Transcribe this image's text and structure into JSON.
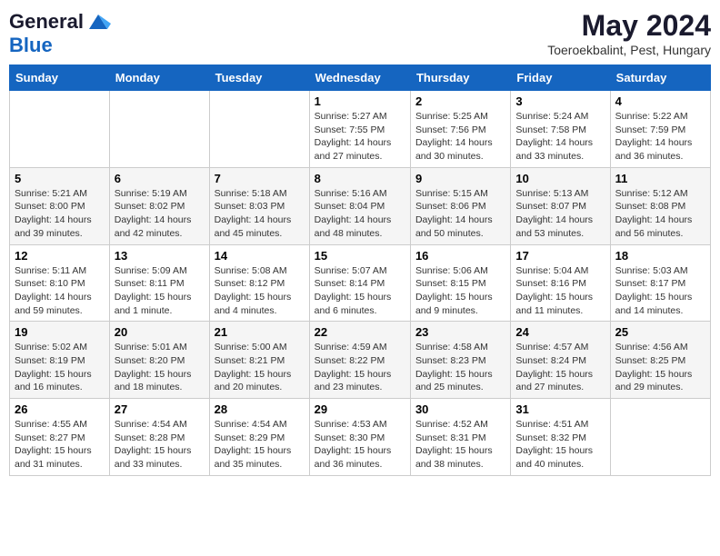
{
  "header": {
    "logo_general": "General",
    "logo_blue": "Blue",
    "month_year": "May 2024",
    "location": "Toeroekbalint, Pest, Hungary"
  },
  "weekdays": [
    "Sunday",
    "Monday",
    "Tuesday",
    "Wednesday",
    "Thursday",
    "Friday",
    "Saturday"
  ],
  "weeks": [
    [
      {
        "day": "",
        "info": ""
      },
      {
        "day": "",
        "info": ""
      },
      {
        "day": "",
        "info": ""
      },
      {
        "day": "1",
        "info": "Sunrise: 5:27 AM\nSunset: 7:55 PM\nDaylight: 14 hours\nand 27 minutes."
      },
      {
        "day": "2",
        "info": "Sunrise: 5:25 AM\nSunset: 7:56 PM\nDaylight: 14 hours\nand 30 minutes."
      },
      {
        "day": "3",
        "info": "Sunrise: 5:24 AM\nSunset: 7:58 PM\nDaylight: 14 hours\nand 33 minutes."
      },
      {
        "day": "4",
        "info": "Sunrise: 5:22 AM\nSunset: 7:59 PM\nDaylight: 14 hours\nand 36 minutes."
      }
    ],
    [
      {
        "day": "5",
        "info": "Sunrise: 5:21 AM\nSunset: 8:00 PM\nDaylight: 14 hours\nand 39 minutes."
      },
      {
        "day": "6",
        "info": "Sunrise: 5:19 AM\nSunset: 8:02 PM\nDaylight: 14 hours\nand 42 minutes."
      },
      {
        "day": "7",
        "info": "Sunrise: 5:18 AM\nSunset: 8:03 PM\nDaylight: 14 hours\nand 45 minutes."
      },
      {
        "day": "8",
        "info": "Sunrise: 5:16 AM\nSunset: 8:04 PM\nDaylight: 14 hours\nand 48 minutes."
      },
      {
        "day": "9",
        "info": "Sunrise: 5:15 AM\nSunset: 8:06 PM\nDaylight: 14 hours\nand 50 minutes."
      },
      {
        "day": "10",
        "info": "Sunrise: 5:13 AM\nSunset: 8:07 PM\nDaylight: 14 hours\nand 53 minutes."
      },
      {
        "day": "11",
        "info": "Sunrise: 5:12 AM\nSunset: 8:08 PM\nDaylight: 14 hours\nand 56 minutes."
      }
    ],
    [
      {
        "day": "12",
        "info": "Sunrise: 5:11 AM\nSunset: 8:10 PM\nDaylight: 14 hours\nand 59 minutes."
      },
      {
        "day": "13",
        "info": "Sunrise: 5:09 AM\nSunset: 8:11 PM\nDaylight: 15 hours\nand 1 minute."
      },
      {
        "day": "14",
        "info": "Sunrise: 5:08 AM\nSunset: 8:12 PM\nDaylight: 15 hours\nand 4 minutes."
      },
      {
        "day": "15",
        "info": "Sunrise: 5:07 AM\nSunset: 8:14 PM\nDaylight: 15 hours\nand 6 minutes."
      },
      {
        "day": "16",
        "info": "Sunrise: 5:06 AM\nSunset: 8:15 PM\nDaylight: 15 hours\nand 9 minutes."
      },
      {
        "day": "17",
        "info": "Sunrise: 5:04 AM\nSunset: 8:16 PM\nDaylight: 15 hours\nand 11 minutes."
      },
      {
        "day": "18",
        "info": "Sunrise: 5:03 AM\nSunset: 8:17 PM\nDaylight: 15 hours\nand 14 minutes."
      }
    ],
    [
      {
        "day": "19",
        "info": "Sunrise: 5:02 AM\nSunset: 8:19 PM\nDaylight: 15 hours\nand 16 minutes."
      },
      {
        "day": "20",
        "info": "Sunrise: 5:01 AM\nSunset: 8:20 PM\nDaylight: 15 hours\nand 18 minutes."
      },
      {
        "day": "21",
        "info": "Sunrise: 5:00 AM\nSunset: 8:21 PM\nDaylight: 15 hours\nand 20 minutes."
      },
      {
        "day": "22",
        "info": "Sunrise: 4:59 AM\nSunset: 8:22 PM\nDaylight: 15 hours\nand 23 minutes."
      },
      {
        "day": "23",
        "info": "Sunrise: 4:58 AM\nSunset: 8:23 PM\nDaylight: 15 hours\nand 25 minutes."
      },
      {
        "day": "24",
        "info": "Sunrise: 4:57 AM\nSunset: 8:24 PM\nDaylight: 15 hours\nand 27 minutes."
      },
      {
        "day": "25",
        "info": "Sunrise: 4:56 AM\nSunset: 8:25 PM\nDaylight: 15 hours\nand 29 minutes."
      }
    ],
    [
      {
        "day": "26",
        "info": "Sunrise: 4:55 AM\nSunset: 8:27 PM\nDaylight: 15 hours\nand 31 minutes."
      },
      {
        "day": "27",
        "info": "Sunrise: 4:54 AM\nSunset: 8:28 PM\nDaylight: 15 hours\nand 33 minutes."
      },
      {
        "day": "28",
        "info": "Sunrise: 4:54 AM\nSunset: 8:29 PM\nDaylight: 15 hours\nand 35 minutes."
      },
      {
        "day": "29",
        "info": "Sunrise: 4:53 AM\nSunset: 8:30 PM\nDaylight: 15 hours\nand 36 minutes."
      },
      {
        "day": "30",
        "info": "Sunrise: 4:52 AM\nSunset: 8:31 PM\nDaylight: 15 hours\nand 38 minutes."
      },
      {
        "day": "31",
        "info": "Sunrise: 4:51 AM\nSunset: 8:32 PM\nDaylight: 15 hours\nand 40 minutes."
      },
      {
        "day": "",
        "info": ""
      }
    ]
  ]
}
